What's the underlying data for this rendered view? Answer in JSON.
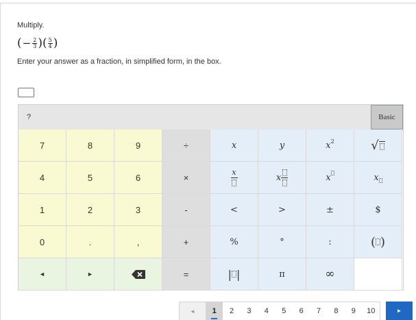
{
  "question": {
    "prompt": "Multiply.",
    "expression": {
      "open_paren": "(",
      "minus": "−",
      "frac1_num": "2",
      "frac1_den": "3",
      "close_paren": ")",
      "frac2_num": "5",
      "frac2_den": "4"
    },
    "instruction": "Enter your answer as a fraction, in simplified form, in the box.",
    "answer_value": ""
  },
  "keypad": {
    "help_label": "?",
    "mode_label": "Basic",
    "keys": {
      "k7": "7",
      "k8": "8",
      "k9": "9",
      "divide": "÷",
      "x": "x",
      "y": "y",
      "x_base": "x",
      "x_exp": "2",
      "k4": "4",
      "k5": "5",
      "k6": "6",
      "times": "×",
      "x_over": "x",
      "x_times": "x",
      "x_pow": "x",
      "x_sub": "x",
      "k1": "1",
      "k2": "2",
      "k3": "3",
      "minus": "-",
      "lt": "<",
      "gt": ">",
      "plusminus": "±",
      "dollar": "$",
      "k0": "0",
      "dot": ".",
      "comma": ",",
      "plus": "+",
      "percent": "%",
      "degree": "°",
      "colon": ":",
      "left": "◄",
      "right": "►",
      "backspace": "⌫",
      "equals": "=",
      "pi": "π",
      "infinity": "∞"
    }
  },
  "pagination": {
    "prev": "◄",
    "pages": [
      "1",
      "2",
      "3",
      "4",
      "5",
      "6",
      "7",
      "8",
      "9",
      "10"
    ],
    "current": "1",
    "next": "►"
  },
  "colors": {
    "number_keys": "#fafad2",
    "operator_keys": "#dedede",
    "symbol_keys": "#e3eef9",
    "nav_keys": "#e9f5e1",
    "next_button": "#1f69c3"
  }
}
